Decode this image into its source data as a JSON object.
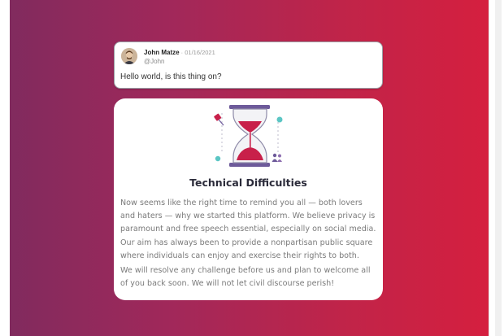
{
  "post": {
    "author": "John Matze",
    "separator": " · ",
    "date": "01/16/2021",
    "handle": "@John",
    "text": "Hello world, is this thing on?"
  },
  "notice": {
    "icon": "hourglass-icon",
    "title": "Technical Difficulties",
    "paragraphs": [
      "Now seems like the right time to remind you all — both lovers and haters — why we started this platform. We believe privacy is paramount and free speech essential, especially on social media. Our aim has always been to provide a nonpartisan public square where individuals can enjoy and exercise their rights to both.",
      "We will resolve any challenge before us and plan to welcome all of you back soon. We will not let civil discourse perish!"
    ]
  },
  "colors": {
    "gradient_start": "#7f2b5e",
    "gradient_end": "#d51f3f",
    "accent": "#c8204a",
    "teal": "#5bc6c4"
  }
}
